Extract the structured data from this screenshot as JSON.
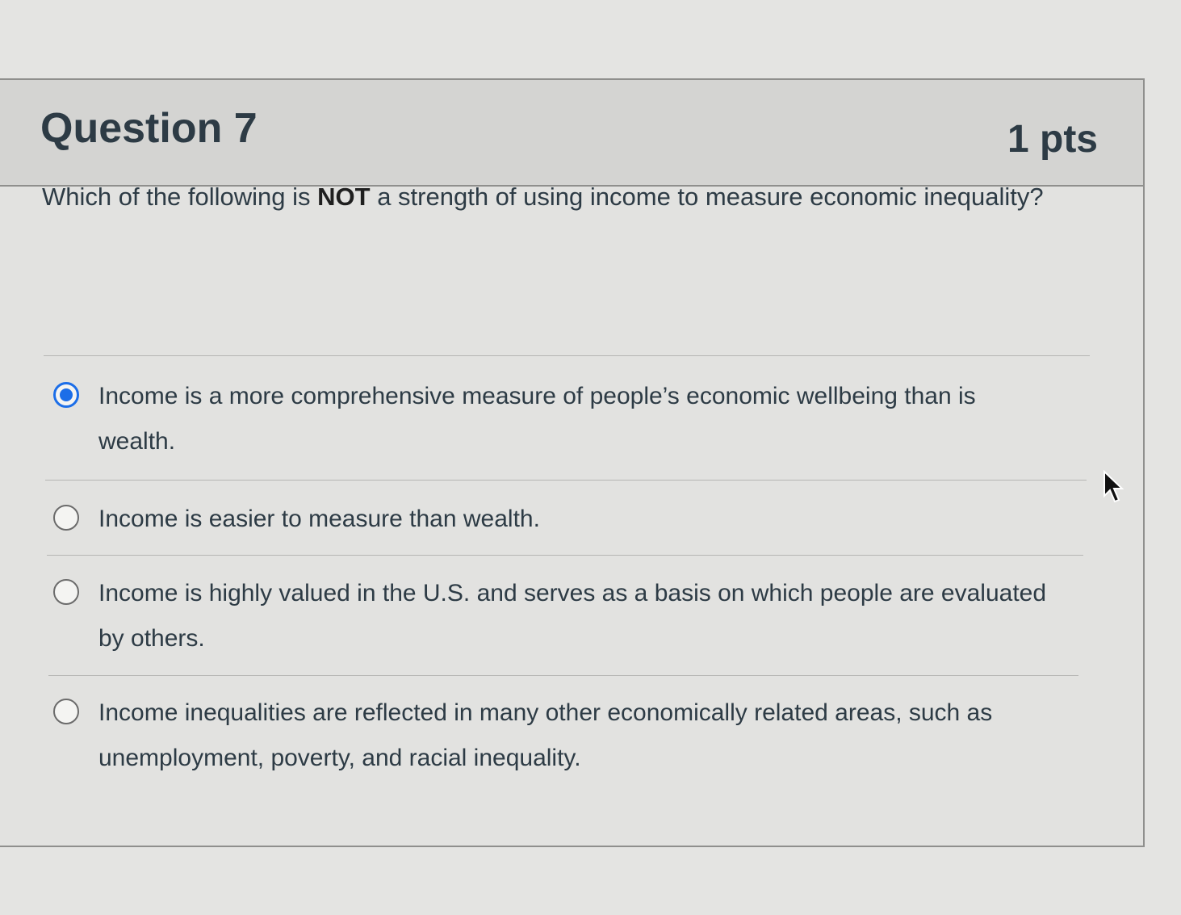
{
  "question": {
    "title": "Question 7",
    "points": "1 pts",
    "prompt_before": "Which of the following is ",
    "prompt_emphasis": "NOT",
    "prompt_after": " a strength of using income to measure economic inequality?"
  },
  "answers": [
    {
      "label": "Income is a more comprehensive measure of people’s economic wellbeing than is wealth.",
      "selected": true
    },
    {
      "label": "Income is easier to measure than wealth.",
      "selected": false
    },
    {
      "label": "Income is highly valued in the U.S. and serves as a basis on which people are evaluated by others.",
      "selected": false
    },
    {
      "label": "Income inequalities are reflected in many other economically related areas, such as unemployment, poverty, and racial inequality.",
      "selected": false
    }
  ],
  "colors": {
    "accent": "#1c6ee8",
    "text": "#2d3b45",
    "header_bg": "#d4d4d2"
  },
  "icons": {
    "cursor": "mouse-pointer-icon"
  }
}
